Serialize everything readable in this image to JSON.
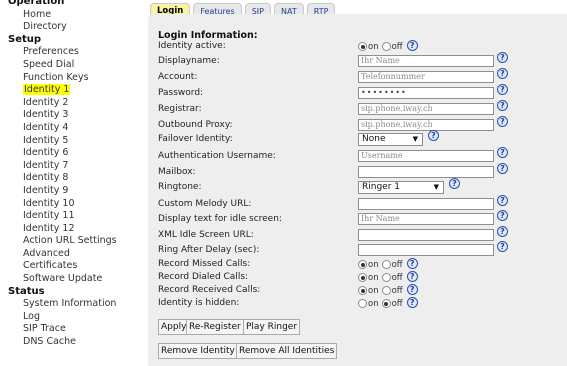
{
  "sidebar": {
    "sections": [
      {
        "title": "Operation",
        "items": [
          "Home",
          "Directory"
        ]
      },
      {
        "title": "Setup",
        "items": [
          "Preferences",
          "Speed Dial",
          "Function Keys",
          "Identity 1",
          "Identity 2",
          "Identity 3",
          "Identity 4",
          "Identity 5",
          "Identity 6",
          "Identity 7",
          "Identity 8",
          "Identity 9",
          "Identity 10",
          "Identity 11",
          "Identity 12",
          "Action URL Settings",
          "Advanced",
          "Certificates",
          "Software Update"
        ]
      },
      {
        "title": "Status",
        "items": [
          "System Information",
          "Log",
          "SIP Trace",
          "DNS Cache"
        ]
      }
    ],
    "active_item": "Identity 1"
  },
  "tabs": [
    "Login",
    "Features",
    "SIP",
    "NAT",
    "RTP"
  ],
  "section_title": "Login Information:",
  "radio_labels": {
    "on": "on",
    "off": "off"
  },
  "help_glyph": "?",
  "fields": {
    "identity_active": {
      "label": "Identity active:",
      "value": "on"
    },
    "displayname": {
      "label": "Displayname:",
      "placeholder": "Ihr Name"
    },
    "account": {
      "label": "Account:",
      "placeholder": "Telefonnummer"
    },
    "password": {
      "label": "Password:",
      "value": "••••••••"
    },
    "registrar": {
      "label": "Registrar:",
      "value": "sip.phone.iway.ch"
    },
    "outbound_proxy": {
      "label": "Outbound Proxy:",
      "value": "sip.phone.iway.ch"
    },
    "failover_identity": {
      "label": "Failover Identity:",
      "value": "None"
    },
    "auth_username": {
      "label": "Authentication Username:",
      "placeholder": "Username"
    },
    "mailbox": {
      "label": "Mailbox:",
      "value": ""
    },
    "ringtone": {
      "label": "Ringtone:",
      "value": "Ringer 1"
    },
    "custom_melody_url": {
      "label": "Custom Melody URL:",
      "value": ""
    },
    "idle_text": {
      "label": "Display text for idle screen:",
      "placeholder": "Ihr Name"
    },
    "xml_idle_url": {
      "label": "XML Idle Screen URL:",
      "value": ""
    },
    "ring_after_delay": {
      "label": "Ring After Delay (sec):",
      "value": ""
    },
    "record_missed": {
      "label": "Record Missed Calls:",
      "value": "on"
    },
    "record_dialed": {
      "label": "Record Dialed Calls:",
      "value": "on"
    },
    "record_received": {
      "label": "Record Received Calls:",
      "value": "on"
    },
    "identity_hidden": {
      "label": "Identity is hidden:",
      "value": "off"
    }
  },
  "buttons": {
    "apply": "Apply",
    "re_register": "Re-Register",
    "play_ringer": "Play Ringer",
    "remove_identity": "Remove Identity",
    "remove_all": "Remove All Identities"
  }
}
